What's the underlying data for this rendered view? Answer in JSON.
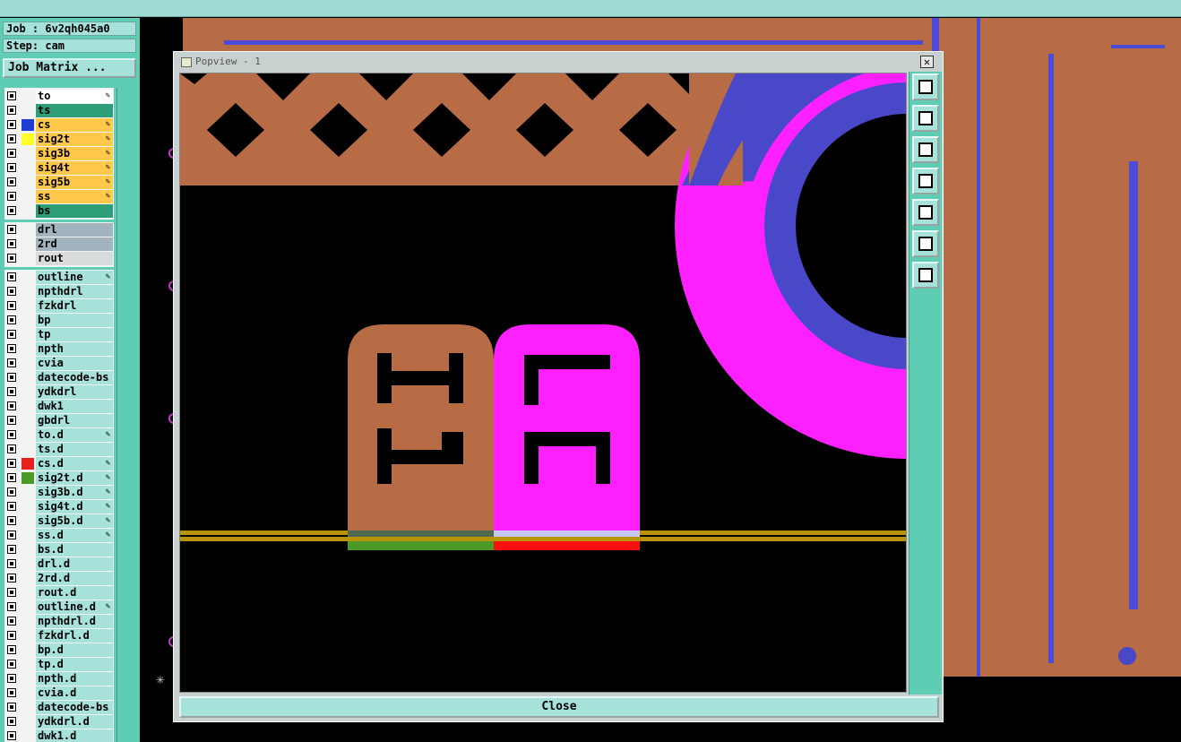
{
  "job_label": "Job : 6v2qh045a0",
  "step_label": "Step: cam",
  "job_matrix_button": "Job Matrix ...",
  "layers": [
    {
      "name": "to",
      "bg": "#ffffff",
      "swatch": "",
      "pen": true
    },
    {
      "name": "ts",
      "bg": "#2e9e78",
      "swatch": "",
      "pen": false
    },
    {
      "name": "cs",
      "bg": "#ffc84a",
      "swatch": "#1e3cd8",
      "pen": true
    },
    {
      "name": "sig2t",
      "bg": "#ffc84a",
      "swatch": "#ffff28",
      "pen": true
    },
    {
      "name": "sig3b",
      "bg": "#ffc84a",
      "swatch": "",
      "pen": true
    },
    {
      "name": "sig4t",
      "bg": "#ffc84a",
      "swatch": "",
      "pen": true
    },
    {
      "name": "sig5b",
      "bg": "#ffc84a",
      "swatch": "",
      "pen": true
    },
    {
      "name": "ss",
      "bg": "#ffc84a",
      "swatch": "",
      "pen": true
    },
    {
      "name": "bs",
      "bg": "#2e9e78",
      "swatch": "",
      "pen": false
    },
    {
      "name": "drl",
      "bg": "#a3b3bd",
      "swatch": "",
      "pen": false
    },
    {
      "name": "2rd",
      "bg": "#a3b3bd",
      "swatch": "",
      "pen": false
    },
    {
      "name": "rout",
      "bg": "#d8dcdc",
      "swatch": "",
      "pen": false
    },
    {
      "name": "outline",
      "bg": "#a6e1da",
      "swatch": "",
      "pen": true
    },
    {
      "name": "npthdrl",
      "bg": "#a6e1da",
      "swatch": "",
      "pen": false
    },
    {
      "name": "fzkdrl",
      "bg": "#a6e1da",
      "swatch": "",
      "pen": false
    },
    {
      "name": "bp",
      "bg": "#a6e1da",
      "swatch": "",
      "pen": false
    },
    {
      "name": "tp",
      "bg": "#a6e1da",
      "swatch": "",
      "pen": false
    },
    {
      "name": "npth",
      "bg": "#a6e1da",
      "swatch": "",
      "pen": false
    },
    {
      "name": "cvia",
      "bg": "#a6e1da",
      "swatch": "",
      "pen": false
    },
    {
      "name": "datecode-bs",
      "bg": "#a6e1da",
      "swatch": "",
      "pen": false
    },
    {
      "name": "ydkdrl",
      "bg": "#a6e1da",
      "swatch": "",
      "pen": false
    },
    {
      "name": "dwk1",
      "bg": "#a6e1da",
      "swatch": "",
      "pen": false
    },
    {
      "name": "gbdrl",
      "bg": "#a6e1da",
      "swatch": "",
      "pen": false
    },
    {
      "name": "to.d",
      "bg": "#a6e1da",
      "swatch": "",
      "pen": true
    },
    {
      "name": "ts.d",
      "bg": "#a6e1da",
      "swatch": "",
      "pen": false
    },
    {
      "name": "cs.d",
      "bg": "#a6e1da",
      "swatch": "#e82020",
      "pen": true
    },
    {
      "name": "sig2t.d",
      "bg": "#a6e1da",
      "swatch": "#4a9a28",
      "pen": true
    },
    {
      "name": "sig3b.d",
      "bg": "#a6e1da",
      "swatch": "",
      "pen": true
    },
    {
      "name": "sig4t.d",
      "bg": "#a6e1da",
      "swatch": "",
      "pen": true
    },
    {
      "name": "sig5b.d",
      "bg": "#a6e1da",
      "swatch": "",
      "pen": true
    },
    {
      "name": "ss.d",
      "bg": "#a6e1da",
      "swatch": "",
      "pen": true
    },
    {
      "name": "bs.d",
      "bg": "#a6e1da",
      "swatch": "",
      "pen": false
    },
    {
      "name": "drl.d",
      "bg": "#a6e1da",
      "swatch": "",
      "pen": false
    },
    {
      "name": "2rd.d",
      "bg": "#a6e1da",
      "swatch": "",
      "pen": false
    },
    {
      "name": "rout.d",
      "bg": "#a6e1da",
      "swatch": "",
      "pen": false
    },
    {
      "name": "outline.d",
      "bg": "#a6e1da",
      "swatch": "",
      "pen": true
    },
    {
      "name": "npthdrl.d",
      "bg": "#a6e1da",
      "swatch": "",
      "pen": false
    },
    {
      "name": "fzkdrl.d",
      "bg": "#a6e1da",
      "swatch": "",
      "pen": false
    },
    {
      "name": "bp.d",
      "bg": "#a6e1da",
      "swatch": "",
      "pen": false
    },
    {
      "name": "tp.d",
      "bg": "#a6e1da",
      "swatch": "",
      "pen": false
    },
    {
      "name": "npth.d",
      "bg": "#a6e1da",
      "swatch": "",
      "pen": false
    },
    {
      "name": "cvia.d",
      "bg": "#a6e1da",
      "swatch": "",
      "pen": false
    },
    {
      "name": "datecode-bs",
      "bg": "#a6e1da",
      "swatch": "",
      "pen": false
    },
    {
      "name": "ydkdrl.d",
      "bg": "#a6e1da",
      "swatch": "",
      "pen": false
    },
    {
      "name": "dwk1.d",
      "bg": "#a6e1da",
      "swatch": "",
      "pen": false
    }
  ],
  "popview": {
    "title": "Popview - 1",
    "close_x": "✕",
    "close_button": "Close",
    "silk_text_left": "I1",
    "silk_text_right": "LC"
  },
  "tool_icons": [
    "zoom-window-icon",
    "pan-up-icon",
    "pan-down-icon",
    "pan-left-icon",
    "pan-right-icon",
    "zoom-fit-icon",
    "zoom-home-icon"
  ],
  "colors": {
    "copper": "#b86c45",
    "magenta": "#ff20ff",
    "blue": "#4848c8",
    "panel_teal": "#5fcdb3"
  }
}
